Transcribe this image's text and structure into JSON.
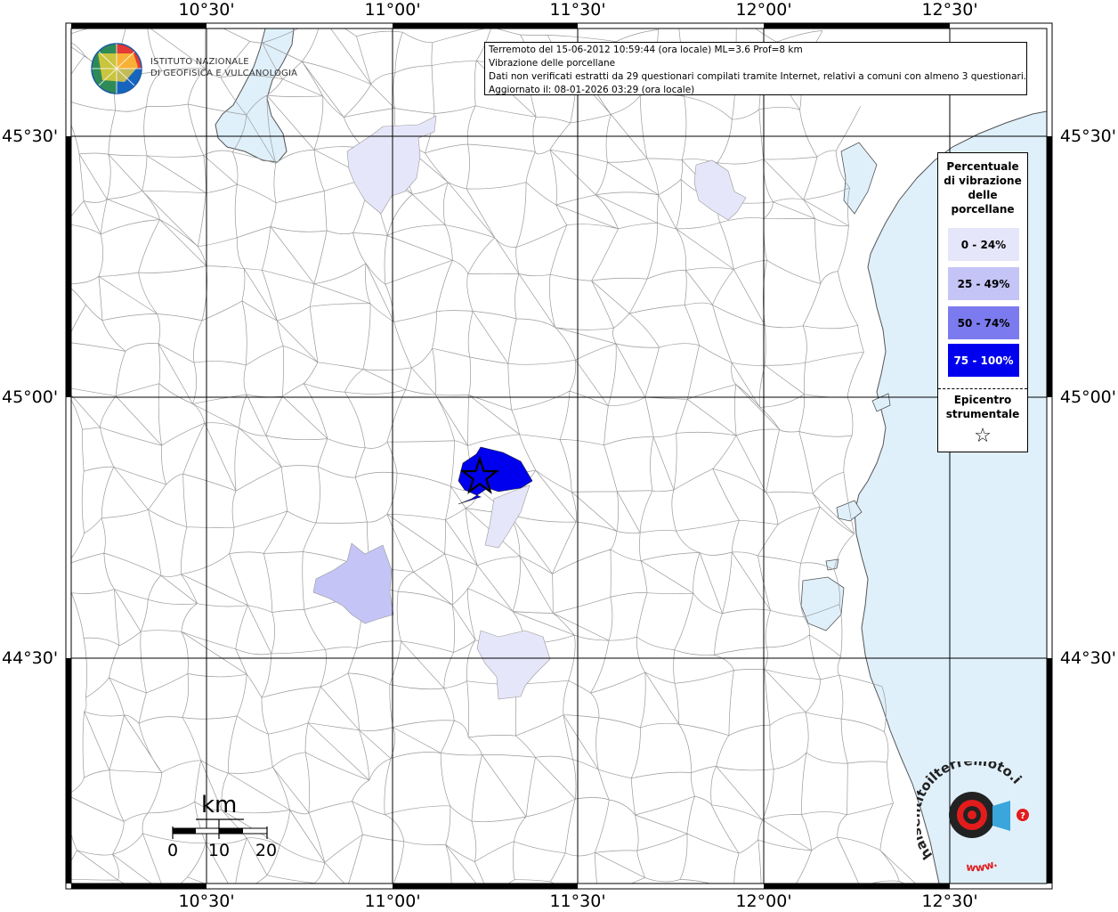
{
  "map": {
    "top_labels": [
      "10°30'",
      "11°00'",
      "11°30'",
      "12°00'",
      "12°30'"
    ],
    "bottom_labels": [
      "10°30'",
      "11°00'",
      "11°30'",
      "12°00'",
      "12°30'"
    ],
    "left_labels": [
      "45°30'",
      "45°00'",
      "44°30'"
    ],
    "right_labels": [
      "45°30'",
      "45°00'",
      "44°30'"
    ]
  },
  "info": {
    "line1": "Terremoto del 15-06-2012 10:59:44 (ora locale) ML=3.6 Prof=8 km",
    "line2": "Vibrazione delle porcellane",
    "line3": "Dati non verificati estratti da 29 questionari compilati tramite Internet, relativi a comuni con almeno 3 questionari.",
    "line4": "Aggiornato il: 08-01-2026 03:29 (ora locale)"
  },
  "logo": {
    "line1": "ISTITUTO NAZIONALE",
    "line2": "DI GEOFISICA E VULCANOLOGIA"
  },
  "legend": {
    "title_lines": [
      "Percentuale",
      "di vibrazione",
      "delle",
      "porcellane"
    ],
    "classes": [
      {
        "label": "0 - 24%",
        "color": "#e6e6fa"
      },
      {
        "label": "25 - 49%",
        "color": "#c4c4f6"
      },
      {
        "label": "50 - 74%",
        "color": "#7b7bef"
      },
      {
        "label": "75 - 100%",
        "color": "#0000ee"
      }
    ],
    "epicenter_lines": [
      "Epicentro",
      "strumentale"
    ],
    "epicenter_symbol": "☆"
  },
  "scale": {
    "unit": "km",
    "ticks": [
      "0",
      "10",
      "20"
    ]
  },
  "brand": {
    "name": "haisentitoilterremoto.it",
    "prefix": "www.",
    "colors": {
      "dark": "#222222",
      "red": "#e21c1c",
      "blue": "#3aa6dc"
    }
  },
  "colors": {
    "sea": "#dff0fb",
    "lake": "#dff0fb",
    "border": "#9a9a9a",
    "grid": "#000000"
  }
}
